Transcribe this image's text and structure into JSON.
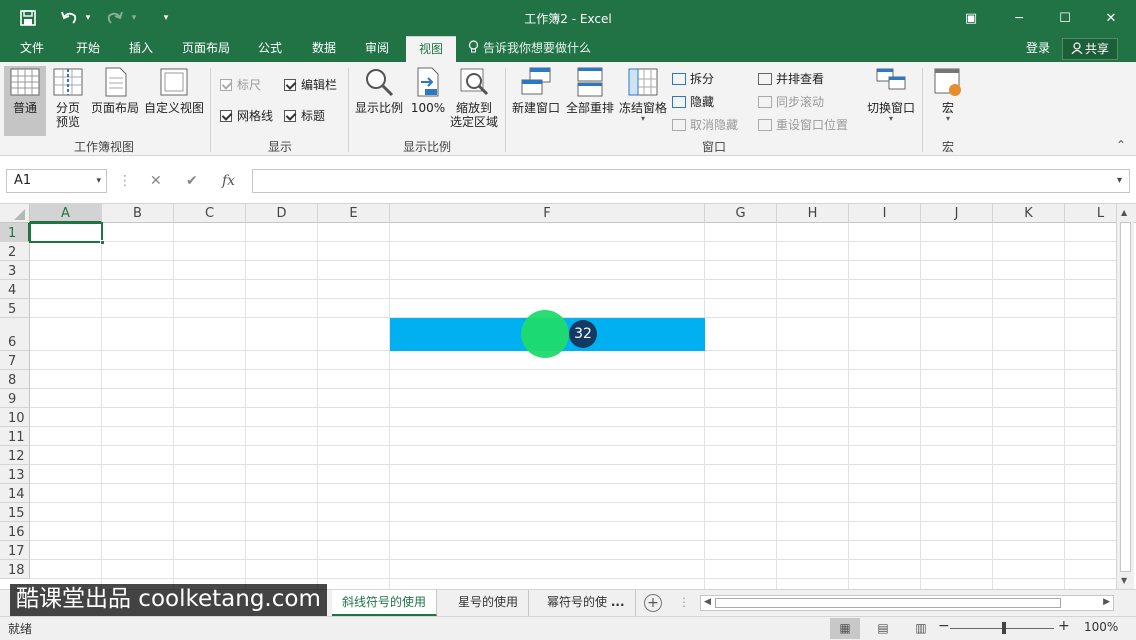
{
  "window": {
    "title": "工作簿2 - Excel",
    "icons": {
      "save": "save-icon",
      "undo": "undo-icon",
      "redo": "redo-icon",
      "customize": "customize-qat-icon",
      "ribbon_options": "ribbon-display-options-icon",
      "minimize": "minimize-icon",
      "maximize": "maximize-icon",
      "close": "close-icon"
    },
    "controls": {
      "undo_dropdown": "▾",
      "redo_dropdown": "▾",
      "customize": "▾",
      "ribbon_options": "▣",
      "minimize": "─",
      "maximize": "☐",
      "close": "✕"
    }
  },
  "tabs": [
    "文件",
    "开始",
    "插入",
    "页面布局",
    "公式",
    "数据",
    "审阅",
    "视图"
  ],
  "active_tab": "视图",
  "tell_me": "告诉我你想要做什么",
  "login": "登录",
  "share": "共享",
  "ribbon": {
    "workbook_views": {
      "group_label": "工作簿视图",
      "normal": "普通",
      "page_break_line1": "分页",
      "page_break_line2": "预览",
      "page_layout": "页面布局",
      "custom_views": "自定义视图"
    },
    "show": {
      "group_label": "显示",
      "ruler": "标尺",
      "formula_bar": "编辑栏",
      "gridlines": "网格线",
      "headings": "标题"
    },
    "zoom": {
      "group_label": "显示比例",
      "zoom": "显示比例",
      "zoom_100": "100%",
      "zoom_to_selection_line1": "缩放到",
      "zoom_to_selection_line2": "选定区域"
    },
    "window": {
      "group_label": "窗口",
      "new_window": "新建窗口",
      "arrange_all": "全部重排",
      "freeze_panes": "冻结窗格",
      "split": "拆分",
      "hide": "隐藏",
      "unhide": "取消隐藏",
      "view_side_by_side": "并排查看",
      "synchronous_scrolling": "同步滚动",
      "reset_window_position": "重设窗口位置",
      "switch_windows": "切换窗口"
    },
    "macros": {
      "group_label": "宏",
      "macros": "宏"
    },
    "collapse": "⌃",
    "dropdown": "▾"
  },
  "formula_bar": {
    "name_box": "A1",
    "cancel": "✕",
    "enter": "✔",
    "fx": "fx",
    "separator": "⋮",
    "name_box_dropdown": "▾",
    "formula_dropdown": "▾",
    "formula": ""
  },
  "grid": {
    "columns": [
      "A",
      "B",
      "C",
      "D",
      "E",
      "F",
      "G",
      "H",
      "I",
      "J",
      "K",
      "L"
    ],
    "rows": [
      "1",
      "2",
      "3",
      "4",
      "5",
      "6",
      "7",
      "8",
      "9",
      "10",
      "11",
      "12",
      "13",
      "14",
      "15",
      "16",
      "17",
      "18"
    ],
    "selected_cell": "A1",
    "highlight_color": "#00b0f0",
    "click_marker_color": "#1fdb6b",
    "step_badge": "32",
    "scroll_up": "▲",
    "scroll_down": "▼"
  },
  "sheets": {
    "tabs": [
      "斜线符号的使用",
      "星号的使用",
      "幂符号的使"
    ],
    "active": "斜线符号的使用",
    "more": "...",
    "add": "+",
    "separator": "⋮",
    "scroll_left": "◀",
    "scroll_right": "▶"
  },
  "watermark": "酷课堂出品 coolketang.com",
  "status": {
    "ready": "就绪",
    "view_normal": "▦",
    "view_page_layout": "▤",
    "view_page_break": "▥",
    "zoom_out": "−",
    "zoom_in": "+",
    "zoom": "100%"
  },
  "colors": {
    "accent": "#217346",
    "ribbon_bg": "#f3f3f3"
  }
}
